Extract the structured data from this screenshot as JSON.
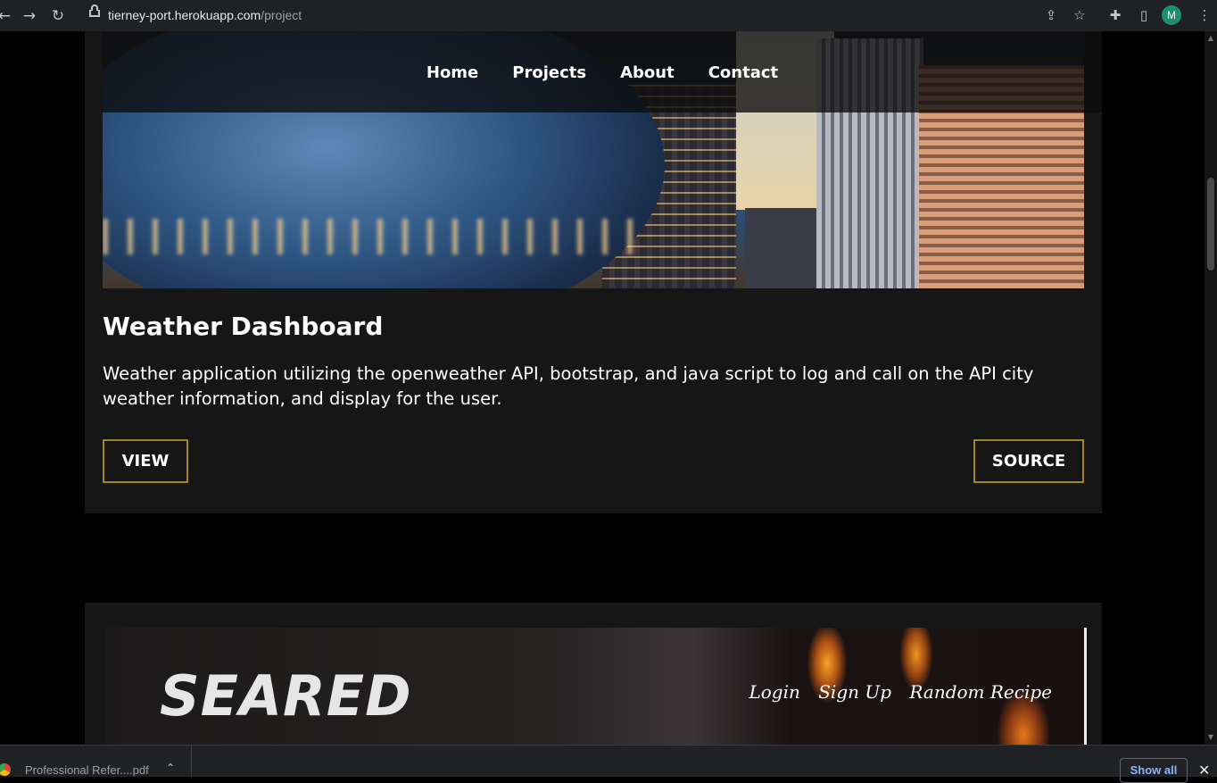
{
  "browser": {
    "url_host": "tierney-port.herokuapp.com",
    "url_path": "/project",
    "profile_initial": "M"
  },
  "nav": {
    "links": [
      "Home",
      "Projects",
      "About",
      "Contact"
    ]
  },
  "project1": {
    "title": "Weather Dashboard",
    "description": "Weather application utilizing the openweather API, bootstrap, and java script to log and call on the API city weather information, and display for the user.",
    "view_label": "VIEW",
    "source_label": "SOURCE"
  },
  "project2": {
    "brand": "SEARED",
    "nav": [
      "Login",
      "Sign Up",
      "Random Recipe"
    ]
  },
  "downloads": {
    "file_name": "Professional Refer....pdf",
    "show_all_label": "Show all"
  },
  "colors": {
    "accent_border": "#a2822a",
    "card_bg": "#161616",
    "page_bg": "#000000"
  }
}
